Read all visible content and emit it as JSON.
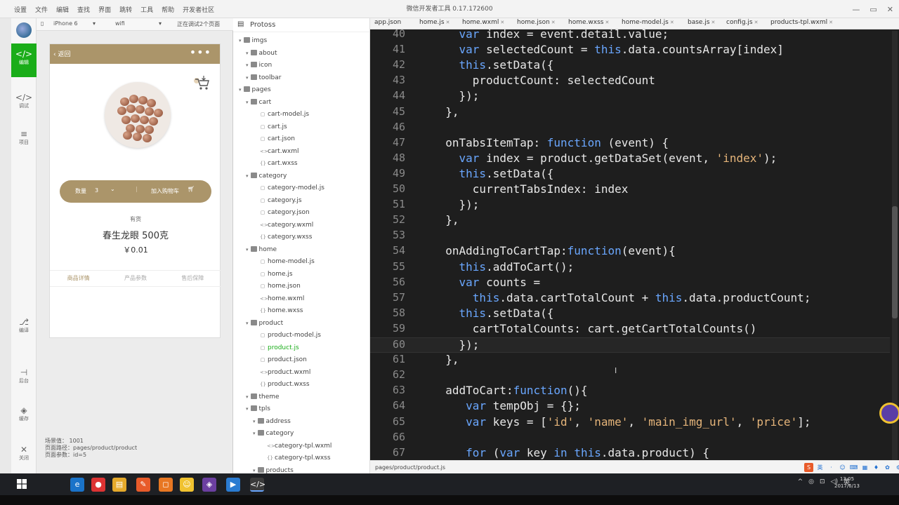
{
  "app": {
    "title": "微信开发者工具 0.17.172600",
    "menu": [
      "设置",
      "文件",
      "编辑",
      "查找",
      "界面",
      "跳转",
      "工具",
      "帮助",
      "开发者社区"
    ],
    "window_controls": [
      "—",
      "▭",
      "✕"
    ]
  },
  "leftbar": {
    "items": [
      {
        "icon": "</>",
        "label": "编辑"
      },
      {
        "icon": "</>",
        "label": "调试"
      },
      {
        "icon": "≡",
        "label": "项目"
      },
      {
        "icon": "⎇",
        "label": "编译"
      },
      {
        "icon": "⊣",
        "label": "后台"
      },
      {
        "icon": "◈",
        "label": "缓存"
      },
      {
        "icon": "✕",
        "label": "关闭"
      }
    ]
  },
  "simulator": {
    "device": "iPhone 6",
    "network": "wifi",
    "debug_status": "正在调试2个页面",
    "nav_back": "返回",
    "nav_more": "•••",
    "order": {
      "qty_label": "数量",
      "qty_value": "3",
      "add_label": "加入购物车"
    },
    "product": {
      "tag": "有货",
      "name": "春生龙眼 500克",
      "price": "￥0.01"
    },
    "tabs": [
      "商品详情",
      "产品参数",
      "售后保障"
    ],
    "scene": {
      "scene_line": "场景值：   1001",
      "path_line": "页面路径：pages/product/product",
      "params_line": "页面参数：id=5"
    }
  },
  "tree": {
    "project": "Protoss",
    "nodes": [
      {
        "label": "imgs",
        "type": "folder",
        "depth": 0
      },
      {
        "label": "about",
        "type": "folder",
        "depth": 1
      },
      {
        "label": "icon",
        "type": "folder",
        "depth": 1
      },
      {
        "label": "toolbar",
        "type": "folder",
        "depth": 1
      },
      {
        "label": "pages",
        "type": "folder",
        "depth": 0
      },
      {
        "label": "cart",
        "type": "folder",
        "depth": 1
      },
      {
        "label": "cart-model.js",
        "type": "js",
        "depth": 2
      },
      {
        "label": "cart.js",
        "type": "js",
        "depth": 2
      },
      {
        "label": "cart.json",
        "type": "js",
        "depth": 2
      },
      {
        "label": "cart.wxml",
        "type": "xml",
        "depth": 2
      },
      {
        "label": "cart.wxss",
        "type": "css",
        "depth": 2
      },
      {
        "label": "category",
        "type": "folder",
        "depth": 1
      },
      {
        "label": "category-model.js",
        "type": "js",
        "depth": 2
      },
      {
        "label": "category.js",
        "type": "js",
        "depth": 2
      },
      {
        "label": "category.json",
        "type": "js",
        "depth": 2
      },
      {
        "label": "category.wxml",
        "type": "xml",
        "depth": 2
      },
      {
        "label": "category.wxss",
        "type": "css",
        "depth": 2
      },
      {
        "label": "home",
        "type": "folder",
        "depth": 1
      },
      {
        "label": "home-model.js",
        "type": "js",
        "depth": 2
      },
      {
        "label": "home.js",
        "type": "js",
        "depth": 2
      },
      {
        "label": "home.json",
        "type": "js",
        "depth": 2
      },
      {
        "label": "home.wxml",
        "type": "xml",
        "depth": 2
      },
      {
        "label": "home.wxss",
        "type": "css",
        "depth": 2
      },
      {
        "label": "product",
        "type": "folder",
        "depth": 1
      },
      {
        "label": "product-model.js",
        "type": "js",
        "depth": 2
      },
      {
        "label": "product.js",
        "type": "js",
        "depth": 2,
        "selected": true
      },
      {
        "label": "product.json",
        "type": "js",
        "depth": 2
      },
      {
        "label": "product.wxml",
        "type": "xml",
        "depth": 2
      },
      {
        "label": "product.wxss",
        "type": "css",
        "depth": 2
      },
      {
        "label": "theme",
        "type": "folder",
        "depth": 1
      },
      {
        "label": "tpls",
        "type": "folder",
        "depth": 1
      },
      {
        "label": "address",
        "type": "folder",
        "depth": 2
      },
      {
        "label": "category",
        "type": "folder",
        "depth": 2
      },
      {
        "label": "category-tpl.wxml",
        "type": "xml",
        "depth": 3
      },
      {
        "label": "category-tpl.wxss",
        "type": "css",
        "depth": 3
      },
      {
        "label": "products",
        "type": "folder",
        "depth": 2
      }
    ]
  },
  "editor": {
    "tabs": [
      {
        "label": "app.json",
        "close": false
      },
      {
        "label": "home.js",
        "close": true
      },
      {
        "label": "home.wxml",
        "close": true
      },
      {
        "label": "home.json",
        "close": true
      },
      {
        "label": "home.wxss",
        "close": true
      },
      {
        "label": "home-model.js",
        "close": true
      },
      {
        "label": "base.js",
        "close": true
      },
      {
        "label": "config.js",
        "close": true
      },
      {
        "label": "products-tpl.wxml",
        "close": true
      }
    ],
    "status_path": "pages/product/product.js",
    "current_line": "60",
    "lines": [
      {
        "n": "40",
        "code": "    var index = event.detail.value;"
      },
      {
        "n": "41",
        "code": "    var selectedCount = this.data.countsArray[index]"
      },
      {
        "n": "42",
        "code": "    this.setData({"
      },
      {
        "n": "43",
        "code": "      productCount: selectedCount"
      },
      {
        "n": "44",
        "code": "    });"
      },
      {
        "n": "45",
        "code": "  },"
      },
      {
        "n": "46",
        "code": ""
      },
      {
        "n": "47",
        "code": "  onTabsItemTap: function (event) {"
      },
      {
        "n": "48",
        "code": "    var index = product.getDataSet(event, 'index');"
      },
      {
        "n": "49",
        "code": "    this.setData({"
      },
      {
        "n": "50",
        "code": "      currentTabsIndex: index"
      },
      {
        "n": "51",
        "code": "    });"
      },
      {
        "n": "52",
        "code": "  },"
      },
      {
        "n": "53",
        "code": ""
      },
      {
        "n": "54",
        "code": "  onAddingToCartTap:function(event){"
      },
      {
        "n": "55",
        "code": "    this.addToCart();"
      },
      {
        "n": "56",
        "code": "    var counts ="
      },
      {
        "n": "57",
        "code": "      this.data.cartTotalCount + this.data.productCount;"
      },
      {
        "n": "58",
        "code": "    this.setData({"
      },
      {
        "n": "59",
        "code": "      cartTotalCounts: cart.getCartTotalCounts()"
      },
      {
        "n": "60",
        "code": "    });"
      },
      {
        "n": "61",
        "code": "  },"
      },
      {
        "n": "62",
        "code": ""
      },
      {
        "n": "63",
        "code": "  addToCart:function(){"
      },
      {
        "n": "64",
        "code": "     var tempObj = {};"
      },
      {
        "n": "65",
        "code": "     var keys = ['id', 'name', 'main_img_url', 'price'];"
      },
      {
        "n": "66",
        "code": ""
      },
      {
        "n": "67",
        "code": "     for (var key in this.data.product) {"
      }
    ]
  },
  "ime": [
    "S",
    "英",
    "·",
    "☺",
    "⌨",
    "▦",
    "♦",
    "✿",
    "⚙"
  ],
  "taskbar": {
    "apps": [
      "e",
      "●",
      "▤",
      "✎",
      "◻",
      "☺",
      "◈",
      "▶",
      "</>"
    ],
    "tray": [
      "^",
      "◎",
      "⊡",
      "◁)",
      "英"
    ],
    "time": "13:05",
    "date": "2017/6/13"
  },
  "colors": {
    "accent": "#ab956a",
    "wechat_green": "#1aad19",
    "editor_bg": "#1e1e1e",
    "keyword": "#6aa7ff",
    "string": "#e6b57a"
  }
}
